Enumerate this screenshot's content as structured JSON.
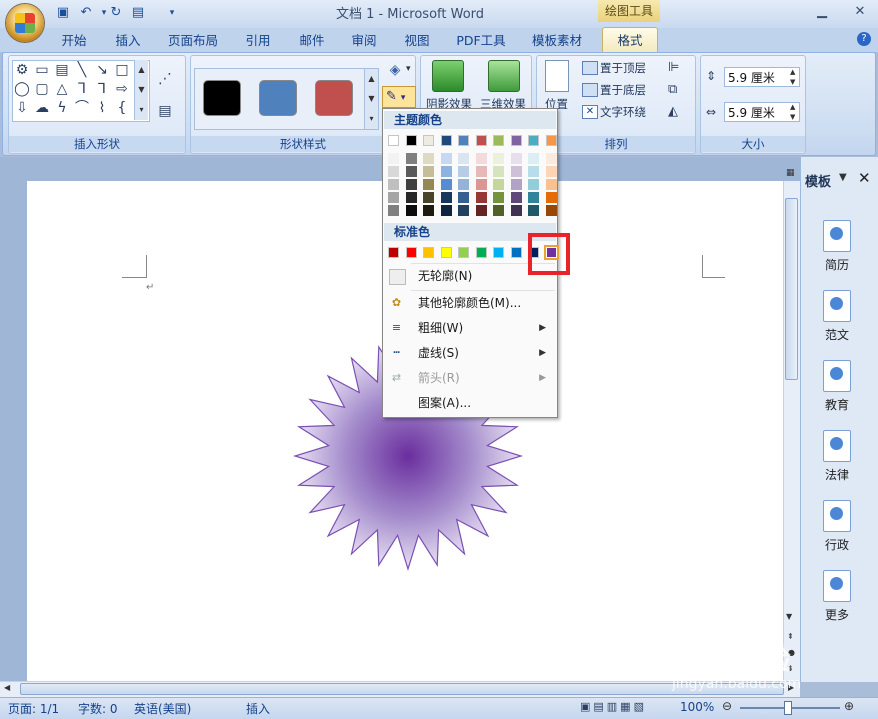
{
  "window": {
    "title": "文档 1 - Microsoft Word",
    "context_tab": "绘图工具"
  },
  "tabs": [
    "开始",
    "插入",
    "页面布局",
    "引用",
    "邮件",
    "审阅",
    "视图",
    "PDF工具",
    "模板素材",
    "格式"
  ],
  "ribbon": {
    "groups": {
      "insert_shapes": "插入形状",
      "shape_styles": "形状样式",
      "arrange": "排列",
      "size": "大小"
    },
    "shadow_effects": "阴影效果",
    "three_d_effects": "三维效果",
    "position": "位置",
    "bring_to_front": "置于顶层",
    "send_to_back": "置于底层",
    "text_wrap": "文字环绕",
    "height_value": "5.9 厘米",
    "width_value": "5.9 厘米",
    "style_colors": [
      "#000000",
      "#4f81bd",
      "#c0504d"
    ]
  },
  "outline_menu": {
    "theme_colors_header": "主题颜色",
    "standard_colors_header": "标准色",
    "theme_top": [
      "#ffffff",
      "#000000",
      "#eeece1",
      "#1f497d",
      "#4f81bd",
      "#c0504d",
      "#9bbb59",
      "#8064a2",
      "#4bacc6",
      "#f79646"
    ],
    "theme_shades": [
      [
        "#f2f2f2",
        "#7f7f7f",
        "#ddd9c3",
        "#c6d9f0",
        "#dbe5f1",
        "#f2dcdb",
        "#ebf1dd",
        "#e5e0ec",
        "#dbeef3",
        "#fdeada"
      ],
      [
        "#d8d8d8",
        "#595959",
        "#c4bd97",
        "#8db3e2",
        "#b8cce4",
        "#e5b9b7",
        "#d7e3bc",
        "#ccc1d9",
        "#b7dde8",
        "#fbd5b5"
      ],
      [
        "#bfbfbf",
        "#3f3f3f",
        "#938953",
        "#548dd4",
        "#95b3d7",
        "#d99694",
        "#c3d69b",
        "#b2a2c7",
        "#92cddc",
        "#fac08f"
      ],
      [
        "#a5a5a5",
        "#262626",
        "#494429",
        "#17365d",
        "#366092",
        "#953734",
        "#76923c",
        "#5f497a",
        "#31859b",
        "#e36c09"
      ],
      [
        "#7f7f7f",
        "#0c0c0c",
        "#1d1b10",
        "#0f243e",
        "#244061",
        "#632423",
        "#4f6128",
        "#3f3151",
        "#205867",
        "#974806"
      ]
    ],
    "standard": [
      "#c00000",
      "#ff0000",
      "#ffc000",
      "#ffff00",
      "#92d050",
      "#00b050",
      "#00b0f0",
      "#0070c0",
      "#002060",
      "#7030a0"
    ],
    "items": [
      {
        "label": "无轮廓(N)",
        "icon": "no-outline-icon",
        "submenu": false
      },
      {
        "label": "其他轮廓颜色(M)...",
        "icon": "palette-icon",
        "submenu": false
      },
      {
        "label": "粗细(W)",
        "icon": "line-weight-icon",
        "submenu": true
      },
      {
        "label": "虚线(S)",
        "icon": "dashes-icon",
        "submenu": true
      },
      {
        "label": "箭头(R)",
        "icon": "arrows-icon",
        "submenu": true,
        "disabled": true
      },
      {
        "label": "图案(A)...",
        "icon": "pattern-icon",
        "submenu": false
      }
    ]
  },
  "task_pane": {
    "title": "模板",
    "items": [
      "简历",
      "范文",
      "教育",
      "法律",
      "行政",
      "更多"
    ]
  },
  "statusbar": {
    "page": "页面: 1/1",
    "words": "字数: 0",
    "language": "英语(美国)",
    "mode": "插入",
    "zoom": "100%"
  },
  "watermark": {
    "logo": "Bai 经验",
    "url": "jingyan.baidu.com"
  }
}
